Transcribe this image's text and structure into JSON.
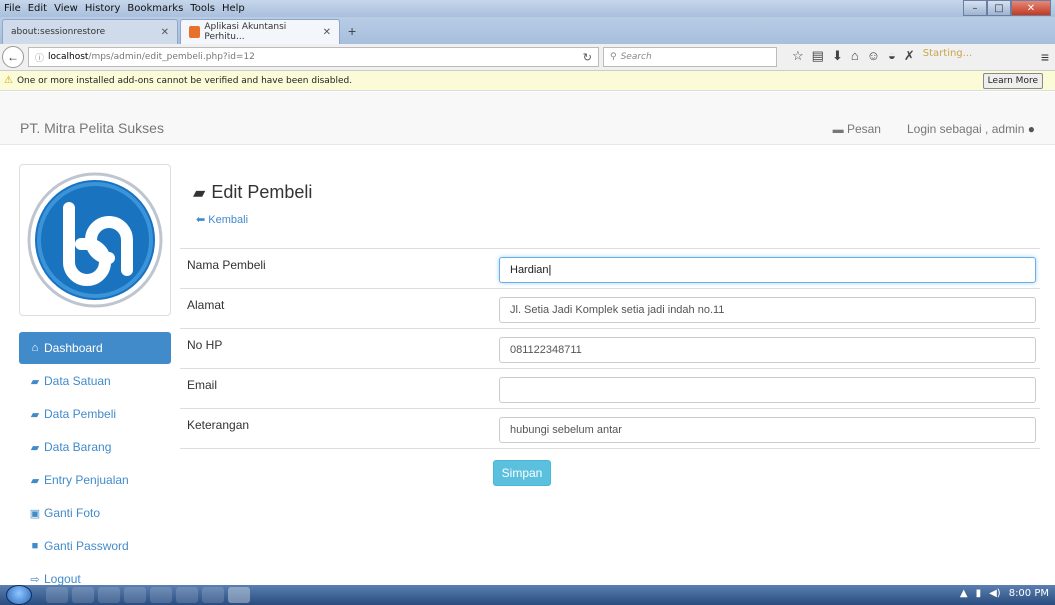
{
  "browser": {
    "menus": [
      "File",
      "Edit",
      "View",
      "History",
      "Bookmarks",
      "Tools",
      "Help"
    ],
    "tabs": [
      {
        "label": "about:sessionrestore"
      },
      {
        "label": "Aplikasi Akuntansi Perhitu..."
      }
    ],
    "url_host": "localhost",
    "url_path": "/mps/admin/edit_pembeli.php?id=12",
    "search_placeholder": "Search",
    "starting_label": "Starting...",
    "notice": "One or more installed add-ons cannot be verified and have been disabled.",
    "learn_more": "Learn More"
  },
  "nav": {
    "brand": "PT. Mitra Pelita Sukses",
    "pesan": "Pesan",
    "login": "Login sebagai , admin"
  },
  "sidebar": {
    "items": [
      {
        "label": "Dashboard",
        "icon": "home-icon"
      },
      {
        "label": "Data Satuan",
        "icon": "briefcase-icon"
      },
      {
        "label": "Data Pembeli",
        "icon": "briefcase-icon"
      },
      {
        "label": "Data Barang",
        "icon": "briefcase-icon"
      },
      {
        "label": "Entry Penjualan",
        "icon": "briefcase-icon"
      },
      {
        "label": "Ganti Foto",
        "icon": "picture-icon"
      },
      {
        "label": "Ganti Password",
        "icon": "lock-icon"
      },
      {
        "label": "Logout",
        "icon": "logout-icon"
      }
    ]
  },
  "main": {
    "title": "Edit Pembeli",
    "back": "Kembali",
    "fields": [
      {
        "label": "Nama Pembeli",
        "value": "Hardian"
      },
      {
        "label": "Alamat",
        "value": "Jl. Setia Jadi Komplek setia jadi indah no.11"
      },
      {
        "label": "No HP",
        "value": "081122348711"
      },
      {
        "label": "Email",
        "value": ""
      },
      {
        "label": "Keterangan",
        "value": "hubungi sebelum antar"
      }
    ],
    "submit": "Simpan"
  },
  "taskbar": {
    "clock": "8:00 PM"
  },
  "colors": {
    "primary": "#428bca",
    "info": "#5bc0de"
  }
}
